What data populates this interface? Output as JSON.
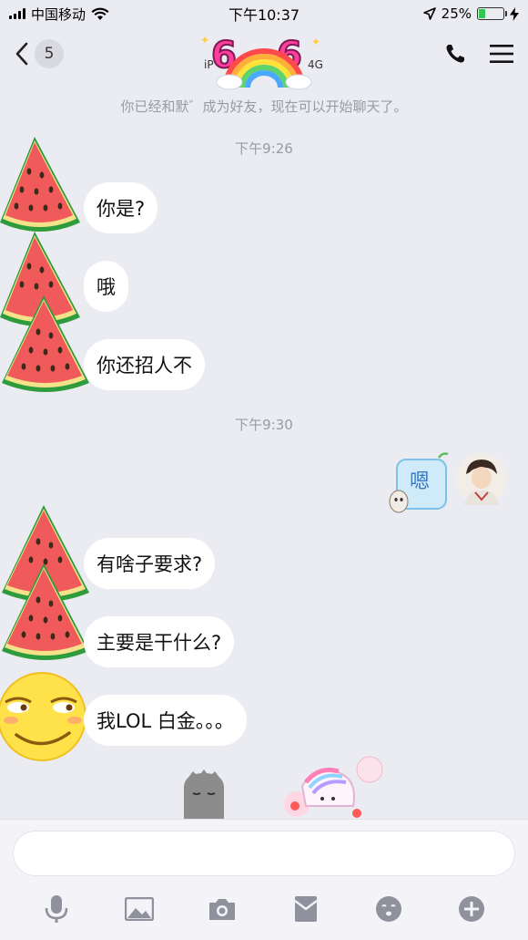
{
  "status_bar": {
    "carrier": "中国移动",
    "time": "下午10:37",
    "battery": "25%",
    "battery_level": 0.25
  },
  "nav": {
    "unread_count": "5",
    "subtitle_left": "iP",
    "subtitle_mid": "i",
    "subtitle_right": "4G"
  },
  "chat": {
    "system_note": "你已经和默゛成为好友，现在可以开始聊天了。",
    "time_1": "下午9:26",
    "time_2": "下午9:30",
    "messages": [
      "你是?",
      "哦",
      "你还招人不",
      "有啥子要求?",
      "主要是干什么?",
      "我LOL 白金。。。"
    ],
    "sticker_text": "嗯"
  },
  "colors": {
    "background": "#ebebf2",
    "accent_green": "#31c94f",
    "bubble": "#ffffff"
  },
  "toolbar_icons": [
    "microphone-icon",
    "image-icon",
    "camera-icon",
    "red-packet-icon",
    "emoji-icon",
    "plus-icon"
  ]
}
